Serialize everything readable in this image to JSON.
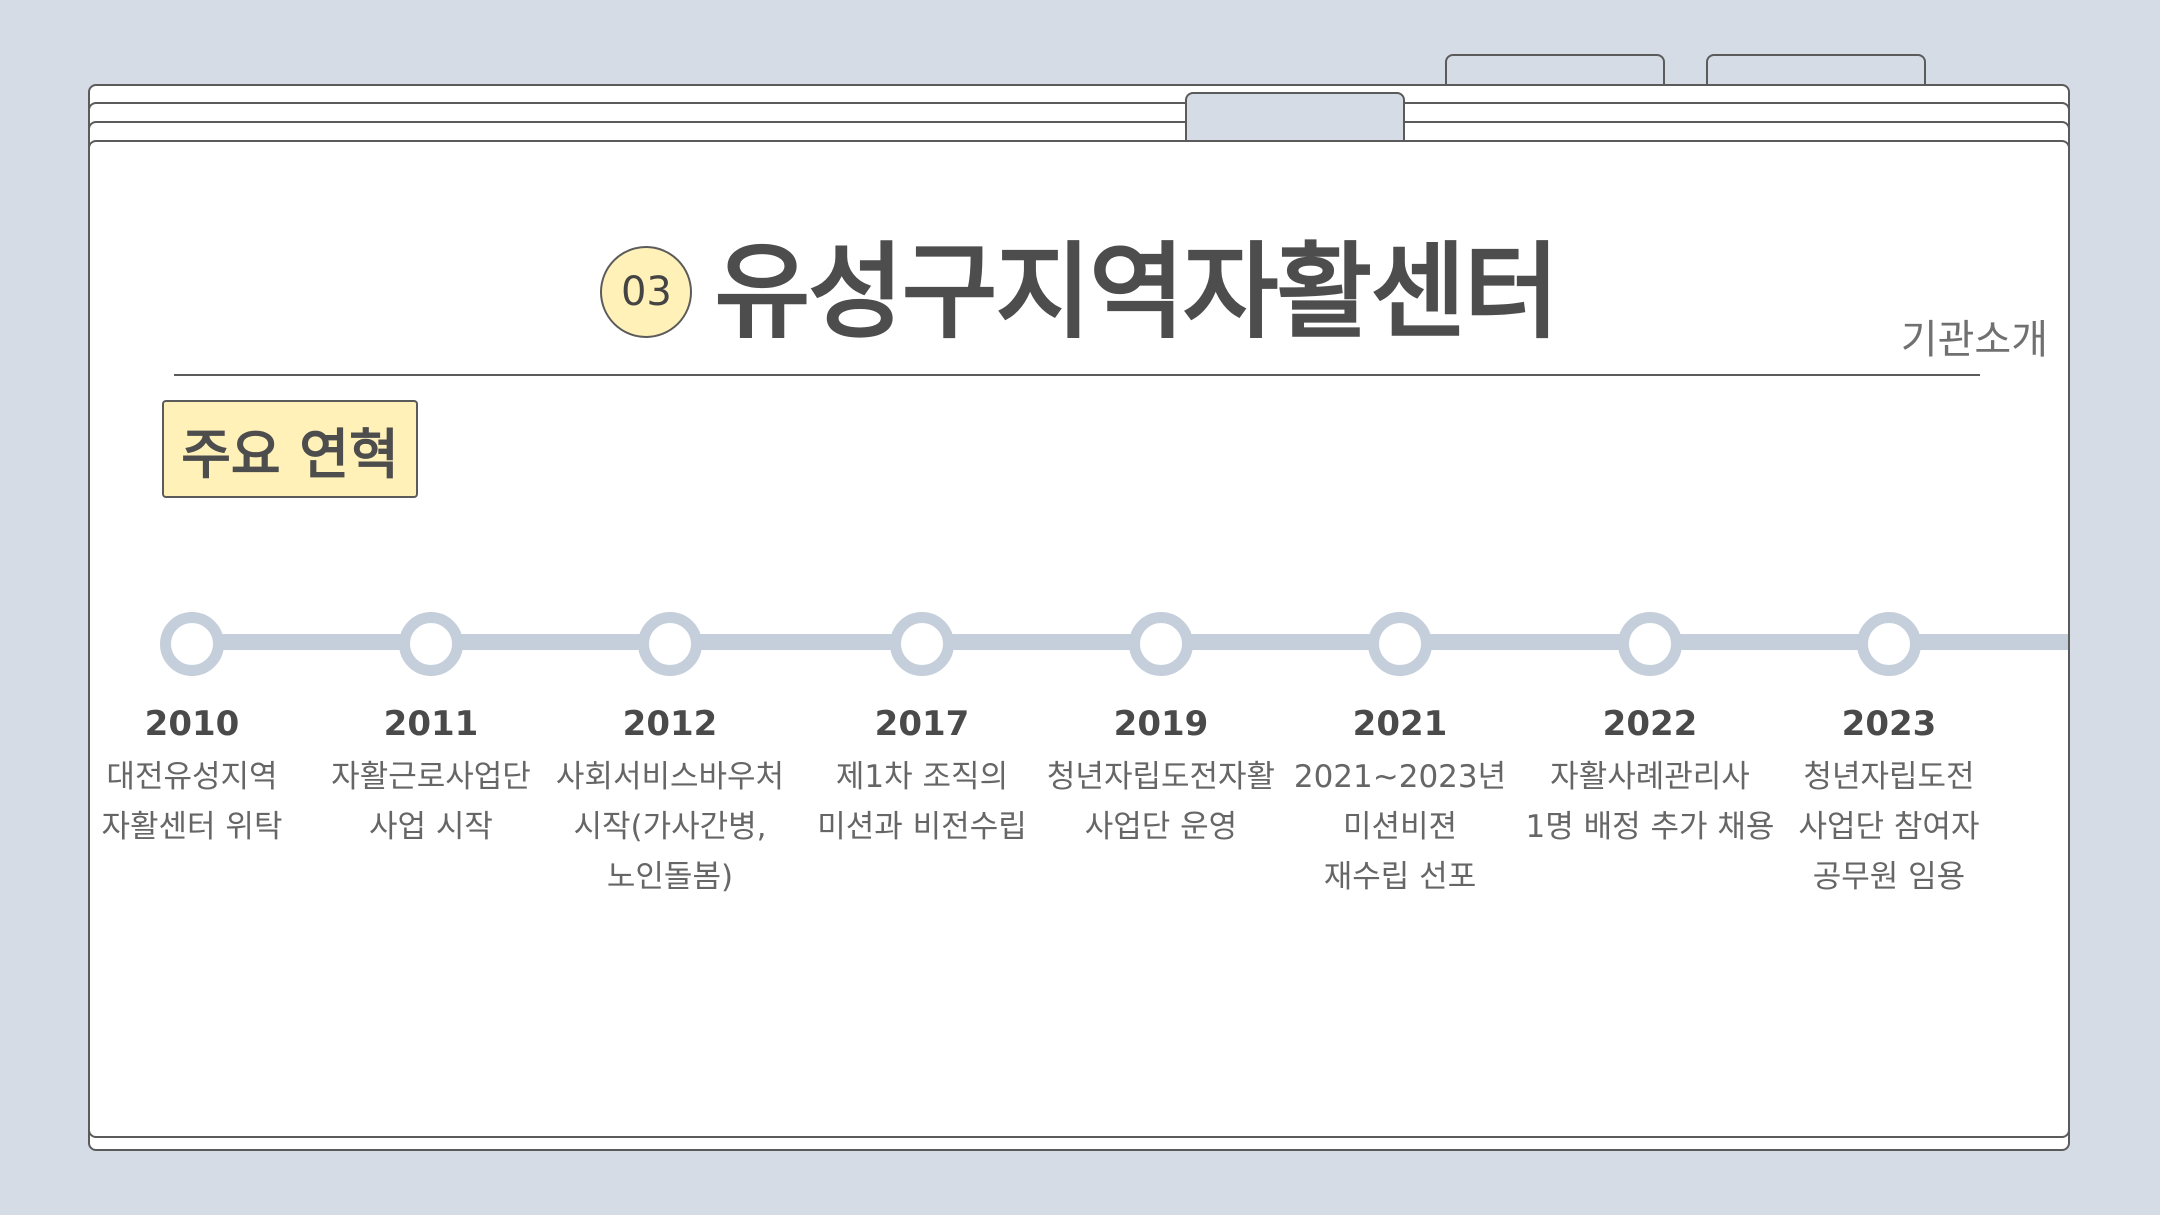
{
  "header": {
    "number": "03",
    "title": "유성구지역자활센터",
    "section": "기관소개"
  },
  "history": {
    "label": "주요 연혁",
    "events": [
      {
        "year": "2010",
        "lines": [
          "대전유성지역",
          "자활센터 위탁"
        ]
      },
      {
        "year": "2011",
        "lines": [
          "자활근로사업단",
          "사업 시작"
        ]
      },
      {
        "year": "2012",
        "lines": [
          "사회서비스바우처",
          "시작(가사간병,",
          "노인돌봄)"
        ]
      },
      {
        "year": "2017",
        "lines": [
          "제1차 조직의",
          "미션과 비전수립"
        ]
      },
      {
        "year": "2019",
        "lines": [
          "청년자립도전자활",
          "사업단 운영"
        ]
      },
      {
        "year": "2021",
        "lines": [
          "2021~2023년",
          "미션비젼",
          "재수립 선포"
        ]
      },
      {
        "year": "2022",
        "lines": [
          "자활사례관리사",
          "1명 배정 추가 채용"
        ]
      },
      {
        "year": "2023",
        "lines": [
          "청년자립도전",
          "사업단 참여자",
          "공무원 임용"
        ]
      }
    ]
  }
}
